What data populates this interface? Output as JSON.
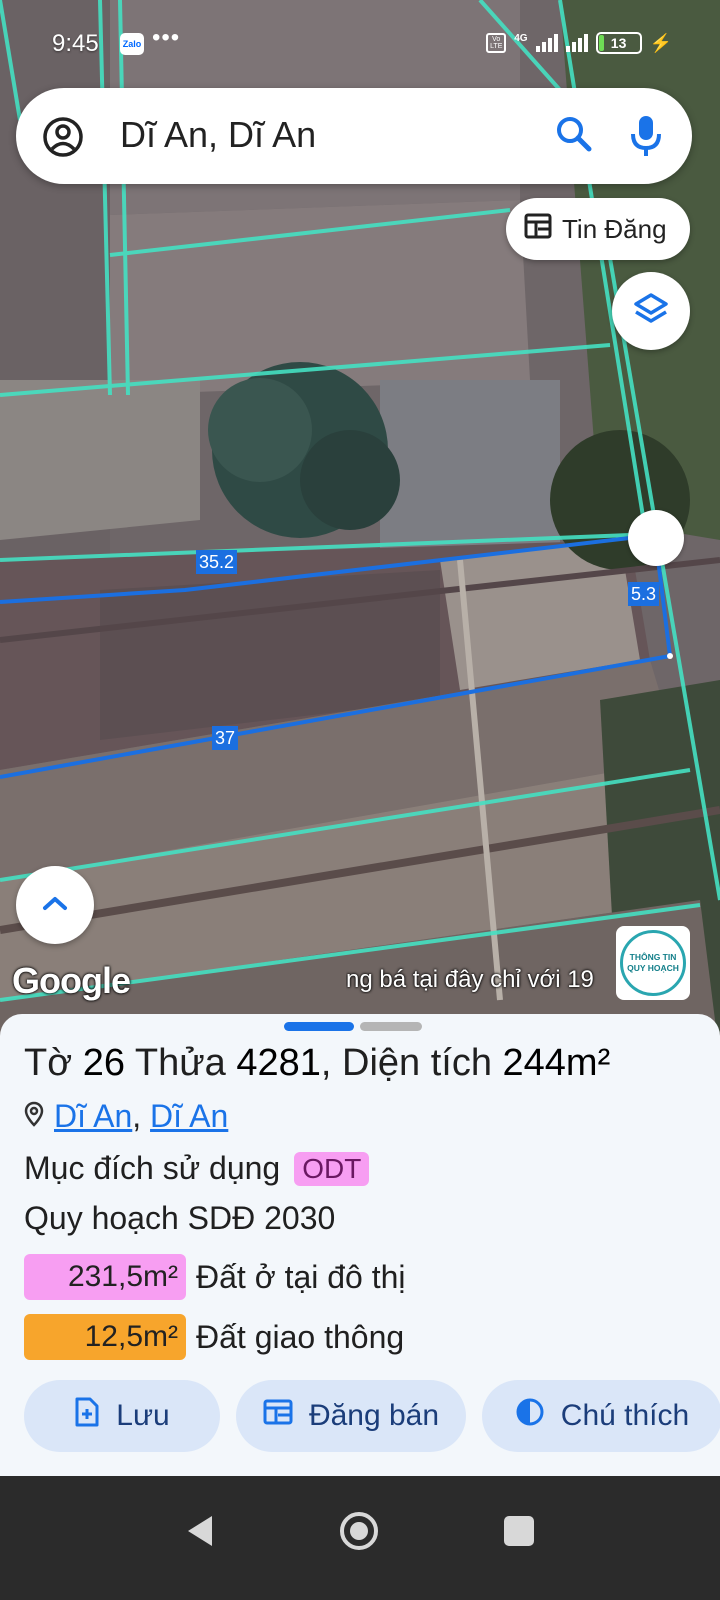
{
  "status_bar": {
    "time": "9:45",
    "app_badge": "Zalo",
    "overflow": "•••",
    "network": "4G",
    "volte": "Vo LTE",
    "battery": "13"
  },
  "search": {
    "query": "Dĩ An, Dĩ An"
  },
  "map": {
    "listing_button": "Tin Đăng",
    "measurements": [
      "35.2",
      "5.3",
      "37"
    ],
    "attribution": "Google",
    "ticker": "ng bá tại đây chỉ với 19",
    "info_logo": [
      "THÔNG TIN",
      "QUY HOẠCH"
    ]
  },
  "parcel": {
    "sheet_label": "Tờ",
    "sheet_no": "26",
    "parcel_label": "Thửa",
    "parcel_no": "4281",
    "area_label": ", Diện tích",
    "area": "244m²",
    "ward": "Dĩ An",
    "district": "Dĩ An",
    "purpose_label": "Mục đích sử dụng",
    "purpose_code": "ODT",
    "plan_label": "Quy hoạch SDĐ 2030",
    "allocations": [
      {
        "amount": "231,5m²",
        "label": "Đất ở tại đô thị",
        "color": "#f79ef2"
      },
      {
        "amount": "12,5m²",
        "label": "Đất giao thông",
        "color": "#f7a52c"
      }
    ]
  },
  "actions": {
    "save": "Lưu",
    "post": "Đăng bán",
    "legend": "Chú thích"
  },
  "colors": {
    "accent": "#1a73e8",
    "parcel_line": "#1b6fe0",
    "plan_line": "#45e0c2"
  }
}
